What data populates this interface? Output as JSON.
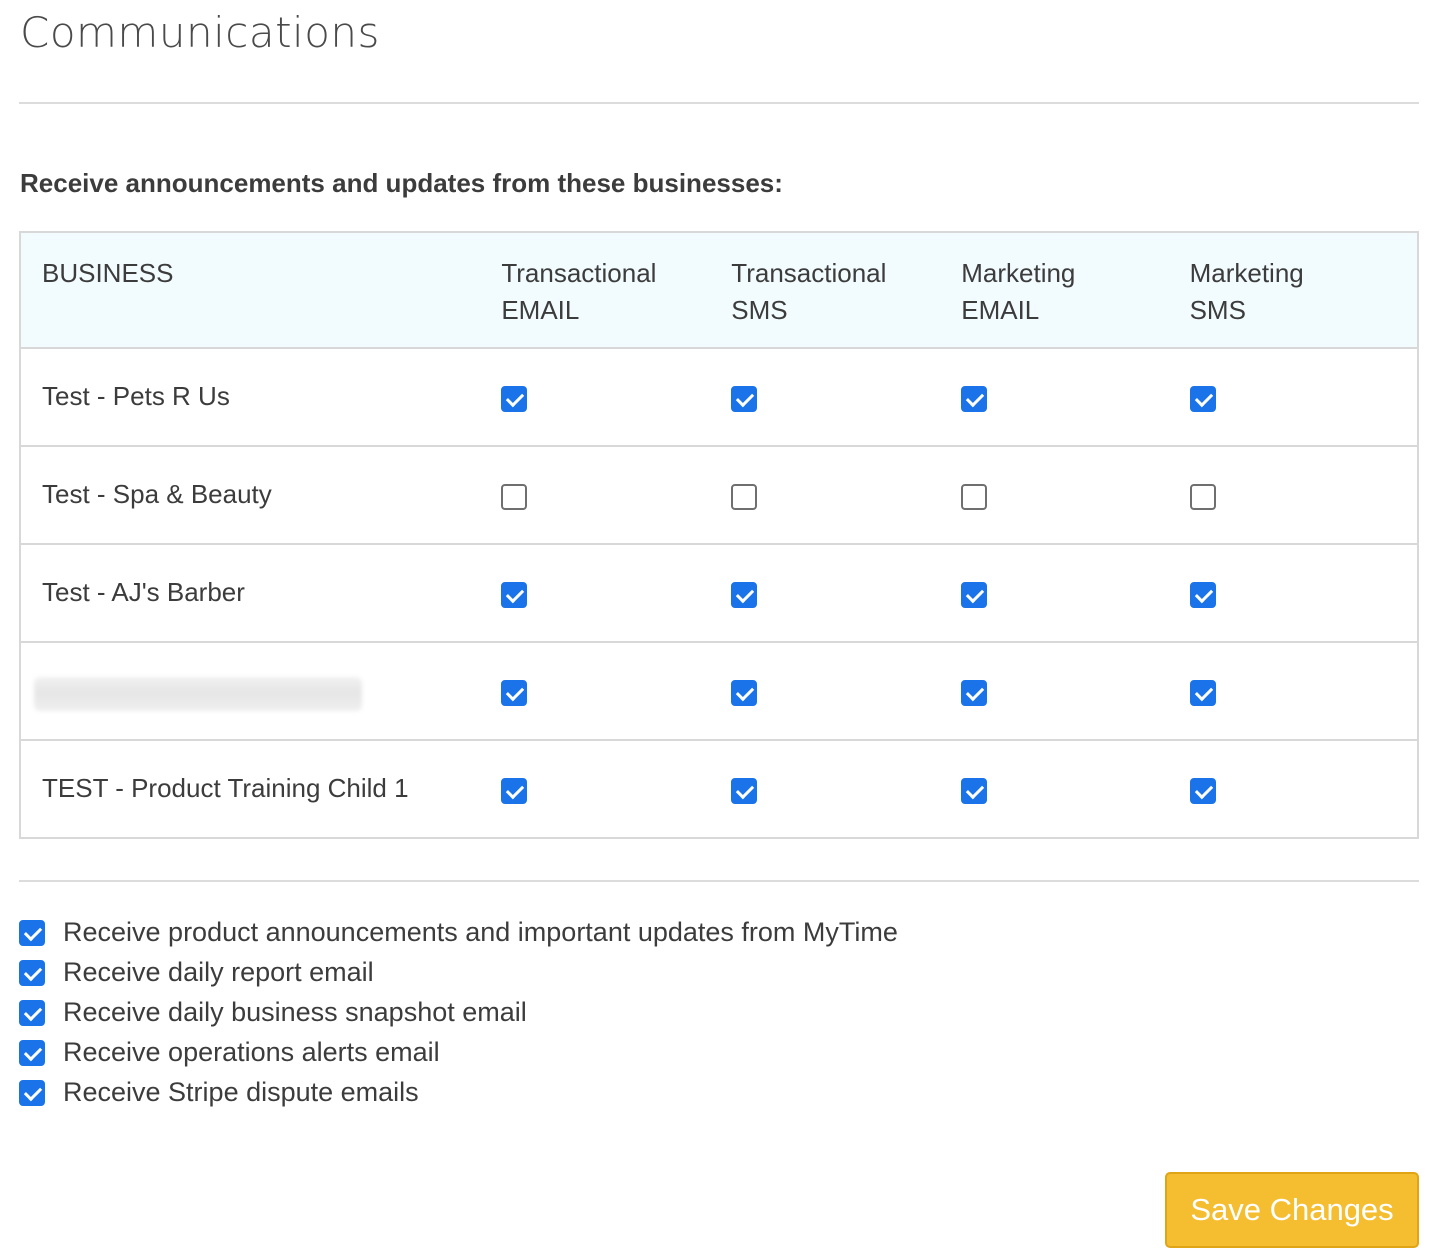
{
  "page": {
    "title": "Communications"
  },
  "businesses_section": {
    "heading": "Receive announcements and updates from these businesses:",
    "columns": {
      "business": "BUSINESS",
      "options": [
        {
          "line1": "Transactional",
          "line2": "EMAIL"
        },
        {
          "line1": "Transactional",
          "line2": "SMS"
        },
        {
          "line1": "Marketing",
          "line2": "EMAIL"
        },
        {
          "line1": "Marketing",
          "line2": "SMS"
        }
      ]
    },
    "rows": [
      {
        "name": "Test - Pets R Us",
        "redacted": false,
        "checked": [
          true,
          true,
          true,
          true
        ]
      },
      {
        "name": "Test - Spa & Beauty",
        "redacted": false,
        "checked": [
          false,
          false,
          false,
          false
        ]
      },
      {
        "name": "Test - AJ's Barber",
        "redacted": false,
        "checked": [
          true,
          true,
          true,
          true
        ]
      },
      {
        "name": "",
        "redacted": true,
        "checked": [
          true,
          true,
          true,
          true
        ]
      },
      {
        "name": "TEST - Product Training Child 1",
        "redacted": false,
        "checked": [
          true,
          true,
          true,
          true
        ]
      }
    ]
  },
  "options": [
    {
      "label": "Receive product announcements and important updates from MyTime",
      "checked": true
    },
    {
      "label": "Receive daily report email",
      "checked": true
    },
    {
      "label": "Receive daily business snapshot email",
      "checked": true
    },
    {
      "label": "Receive operations alerts email",
      "checked": true
    },
    {
      "label": "Receive Stripe dispute emails",
      "checked": true
    }
  ],
  "actions": {
    "save_label": "Save Changes"
  },
  "colors": {
    "checkbox_checked": "#1a73e8",
    "save_button": "#f5bd30",
    "header_bg": "#f2fbfd"
  }
}
